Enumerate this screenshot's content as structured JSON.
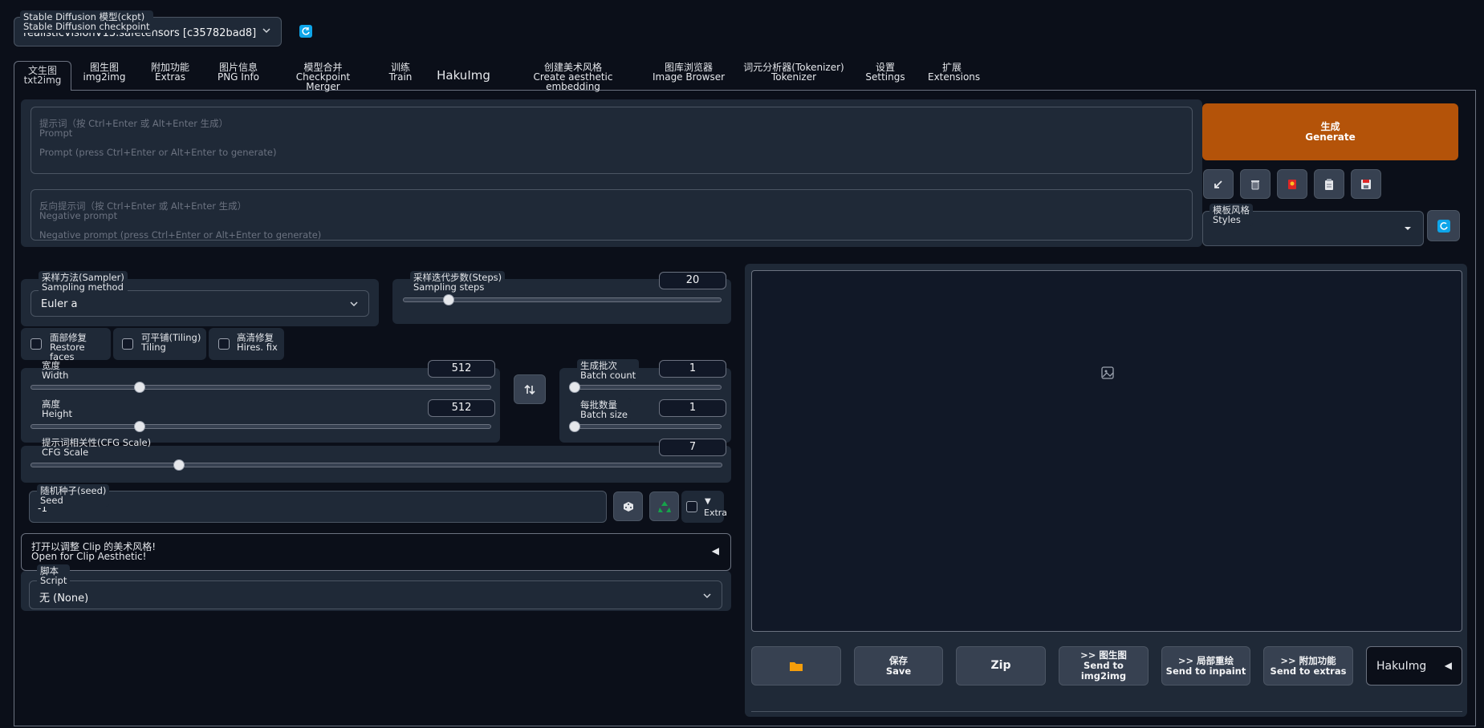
{
  "checkpoint": {
    "label_zh": "Stable Diffusion 模型(ckpt)",
    "label_en": "Stable Diffusion checkpoint",
    "value": "realisticVisionV13.safetensors [c35782bad8]"
  },
  "tabs": [
    {
      "zh": "文生图",
      "en": "txt2img"
    },
    {
      "zh": "图生图",
      "en": "img2img"
    },
    {
      "zh": "附加功能",
      "en": "Extras"
    },
    {
      "zh": "图片信息",
      "en": "PNG Info"
    },
    {
      "zh": "模型合并",
      "en": "Checkpoint Merger"
    },
    {
      "zh": "训练",
      "en": "Train"
    },
    {
      "zh": "HakuImg",
      "en": ""
    },
    {
      "zh": "创建美术风格",
      "en": "Create aesthetic embedding"
    },
    {
      "zh": "图库浏览器",
      "en": "Image Browser"
    },
    {
      "zh": "词元分析器(Tokenizer)",
      "en": "Tokenizer"
    },
    {
      "zh": "设置",
      "en": "Settings"
    },
    {
      "zh": "扩展",
      "en": "Extensions"
    }
  ],
  "prompt": {
    "placeholder_zh": "提示词（按 Ctrl+Enter 或 Alt+Enter 生成）",
    "placeholder_en1": "Prompt",
    "placeholder_en2": "Prompt (press Ctrl+Enter or Alt+Enter to generate)"
  },
  "negative_prompt": {
    "placeholder_zh": "反向提示词（按 Ctrl+Enter 或 Alt+Enter 生成）",
    "placeholder_en1": "Negative prompt",
    "placeholder_en2": "Negative prompt (press Ctrl+Enter or Alt+Enter to generate)"
  },
  "generate": {
    "zh": "生成",
    "en": "Generate",
    "color": "#b45309"
  },
  "styles": {
    "zh": "模板风格",
    "en": "Styles"
  },
  "sampler": {
    "label_zh": "采样方法(Sampler)",
    "label_en": "Sampling method",
    "value": "Euler a"
  },
  "steps": {
    "label_zh": "采样迭代步数(Steps)",
    "label_en": "Sampling steps",
    "value": "20",
    "fraction": 0.13
  },
  "restore_faces": {
    "zh": "面部修复",
    "en": "Restore faces"
  },
  "tiling": {
    "zh": "可平铺(Tiling)",
    "en": "Tiling"
  },
  "hires": {
    "zh": "高清修复",
    "en": "Hires. fix"
  },
  "width": {
    "label_zh": "宽度",
    "label_en": "Width",
    "value": "512",
    "fraction": 0.23
  },
  "height": {
    "label_zh": "高度",
    "label_en": "Height",
    "value": "512",
    "fraction": 0.23
  },
  "batch_count": {
    "label_zh": "生成批次",
    "label_en": "Batch count",
    "value": "1",
    "fraction": 0
  },
  "batch_size": {
    "label_zh": "每批数量",
    "label_en": "Batch size",
    "value": "1",
    "fraction": 0
  },
  "cfg": {
    "label_zh": "提示词相关性(CFG Scale)",
    "label_en": "CFG Scale",
    "value": "7",
    "fraction": 0.21
  },
  "seed": {
    "label_zh": "随机种子(seed)",
    "label_en": "Seed",
    "value": "-1",
    "extra": "Extra"
  },
  "clip_aesthetic": {
    "zh": "打开以调整 Clip 的美术风格!",
    "en": "Open for Clip Aesthetic!"
  },
  "script": {
    "label_zh": "脚本",
    "label_en": "Script",
    "value": "无 (None)"
  },
  "output_buttons": {
    "save_zh": "保存",
    "save_en": "Save",
    "zip": "Zip",
    "img2img_zh": ">> 图生图",
    "img2img_en": "Send to img2img",
    "inpaint_zh": ">> 局部重绘",
    "inpaint_en": "Send to inpaint",
    "extras_zh": ">> 附加功能",
    "extras_en": "Send to extras",
    "hakuimg": "HakuImg"
  }
}
